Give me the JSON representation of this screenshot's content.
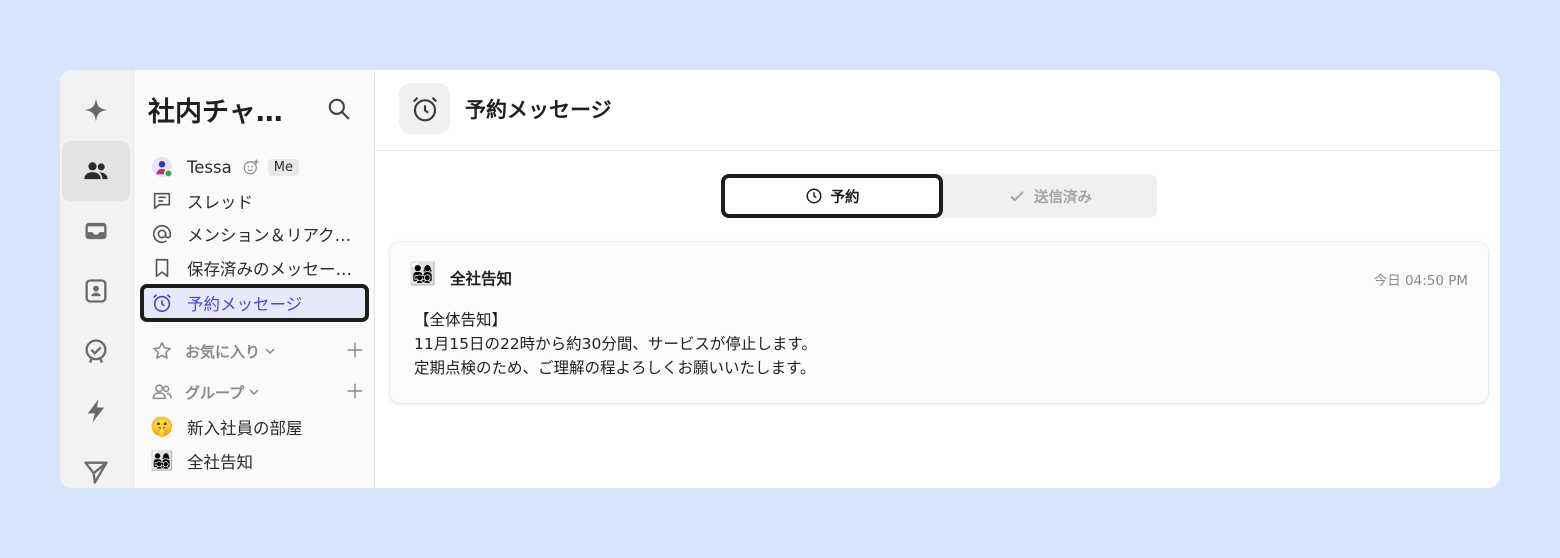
{
  "rail": {
    "items": [
      {
        "icon": "sparkle-icon"
      },
      {
        "icon": "people-icon",
        "active": true
      },
      {
        "icon": "inbox-icon"
      },
      {
        "icon": "contacts-icon"
      },
      {
        "icon": "task-check-icon"
      },
      {
        "icon": "bolt-icon"
      },
      {
        "icon": "send-icon"
      }
    ]
  },
  "sidebar": {
    "workspace_title": "社内チャ…",
    "me": {
      "name": "Tessa",
      "badge": "Me"
    },
    "items": [
      {
        "label": "スレッド",
        "icon": "thread-icon"
      },
      {
        "label": "メンション＆リアク…",
        "icon": "at-icon"
      },
      {
        "label": "保存済みのメッセー…",
        "icon": "bookmark-icon"
      },
      {
        "label": "予約メッセージ",
        "icon": "alarm-icon",
        "selected": true
      }
    ],
    "sections": {
      "favorites": "お気に入り",
      "groups": "グループ"
    },
    "channels": [
      {
        "label": "新入社員の部屋",
        "emoji": "🤫"
      },
      {
        "label": "全社告知",
        "emoji": "👨‍👩‍👧‍👦"
      }
    ]
  },
  "header": {
    "title": "予約メッセージ"
  },
  "tabs": {
    "scheduled": "予約",
    "sent": "送信済み"
  },
  "message": {
    "emoji": "👨‍👩‍👧‍👦",
    "channel": "全社告知",
    "time": "今日 04:50 PM",
    "line1": "【全体告知】",
    "line2": "11月15日の22時から約30分間、サービスが停止します。",
    "line3": "定期点検のため、ご理解の程よろしくお願いいたします。"
  },
  "colors": {
    "background": "#d7e4fc",
    "accent": "#4a45d8",
    "selected_bg": "#e8e8fb"
  }
}
